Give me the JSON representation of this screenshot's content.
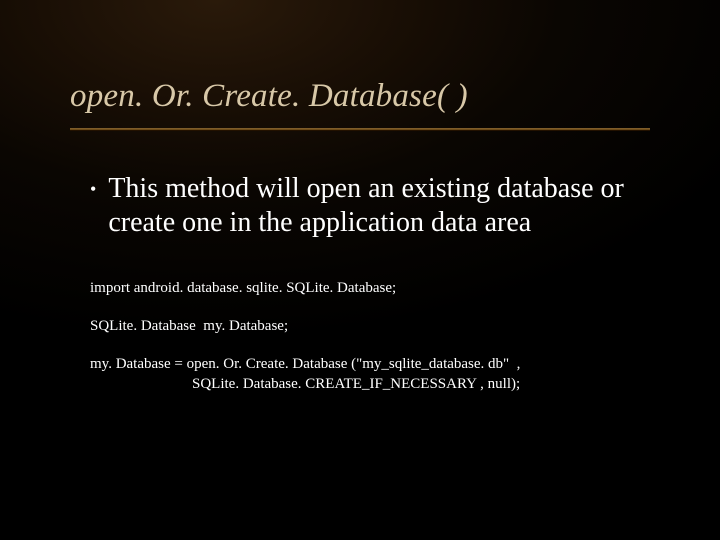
{
  "slide": {
    "title": "open. Or. Create. Database( )",
    "bullet": "This method will open an existing database or create one in the application data area",
    "code": {
      "line1": "import android. database. sqlite. SQLite. Database;",
      "line2": "SQLite. Database  my. Database;",
      "line3a": "my. Database = open. Or. Create. Database (\"my_sqlite_database. db\"  ,",
      "line3b": "SQLite. Database. CREATE_IF_NECESSARY , null);"
    }
  }
}
